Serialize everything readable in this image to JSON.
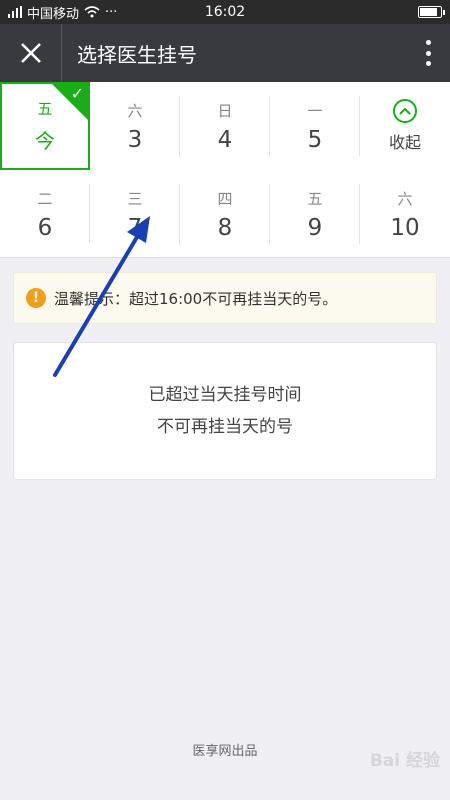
{
  "status_bar": {
    "carrier": "中国移动",
    "time": "16:02",
    "more": "···"
  },
  "header": {
    "title": "选择医生挂号"
  },
  "dates": {
    "row1": [
      {
        "weekday": "五",
        "day": "今",
        "selected": true
      },
      {
        "weekday": "六",
        "day": "3"
      },
      {
        "weekday": "日",
        "day": "4"
      },
      {
        "weekday": "一",
        "day": "5"
      }
    ],
    "collapse_label": "收起",
    "row2": [
      {
        "weekday": "二",
        "day": "6"
      },
      {
        "weekday": "三",
        "day": "7"
      },
      {
        "weekday": "四",
        "day": "8"
      },
      {
        "weekday": "五",
        "day": "9"
      },
      {
        "weekday": "六",
        "day": "10"
      }
    ]
  },
  "tip": {
    "text": "温馨提示：超过16:00不可再挂当天的号。"
  },
  "notice": {
    "line1": "已超过当天挂号时间",
    "line2": "不可再挂当天的号"
  },
  "footer": {
    "text": "医享网出品"
  },
  "watermark": {
    "text": "Bai 经验"
  },
  "colors": {
    "accent": "#1aad19",
    "header_bg": "#393a3f",
    "warning": "#f19e1b",
    "arrow": "#1a3fb0"
  }
}
